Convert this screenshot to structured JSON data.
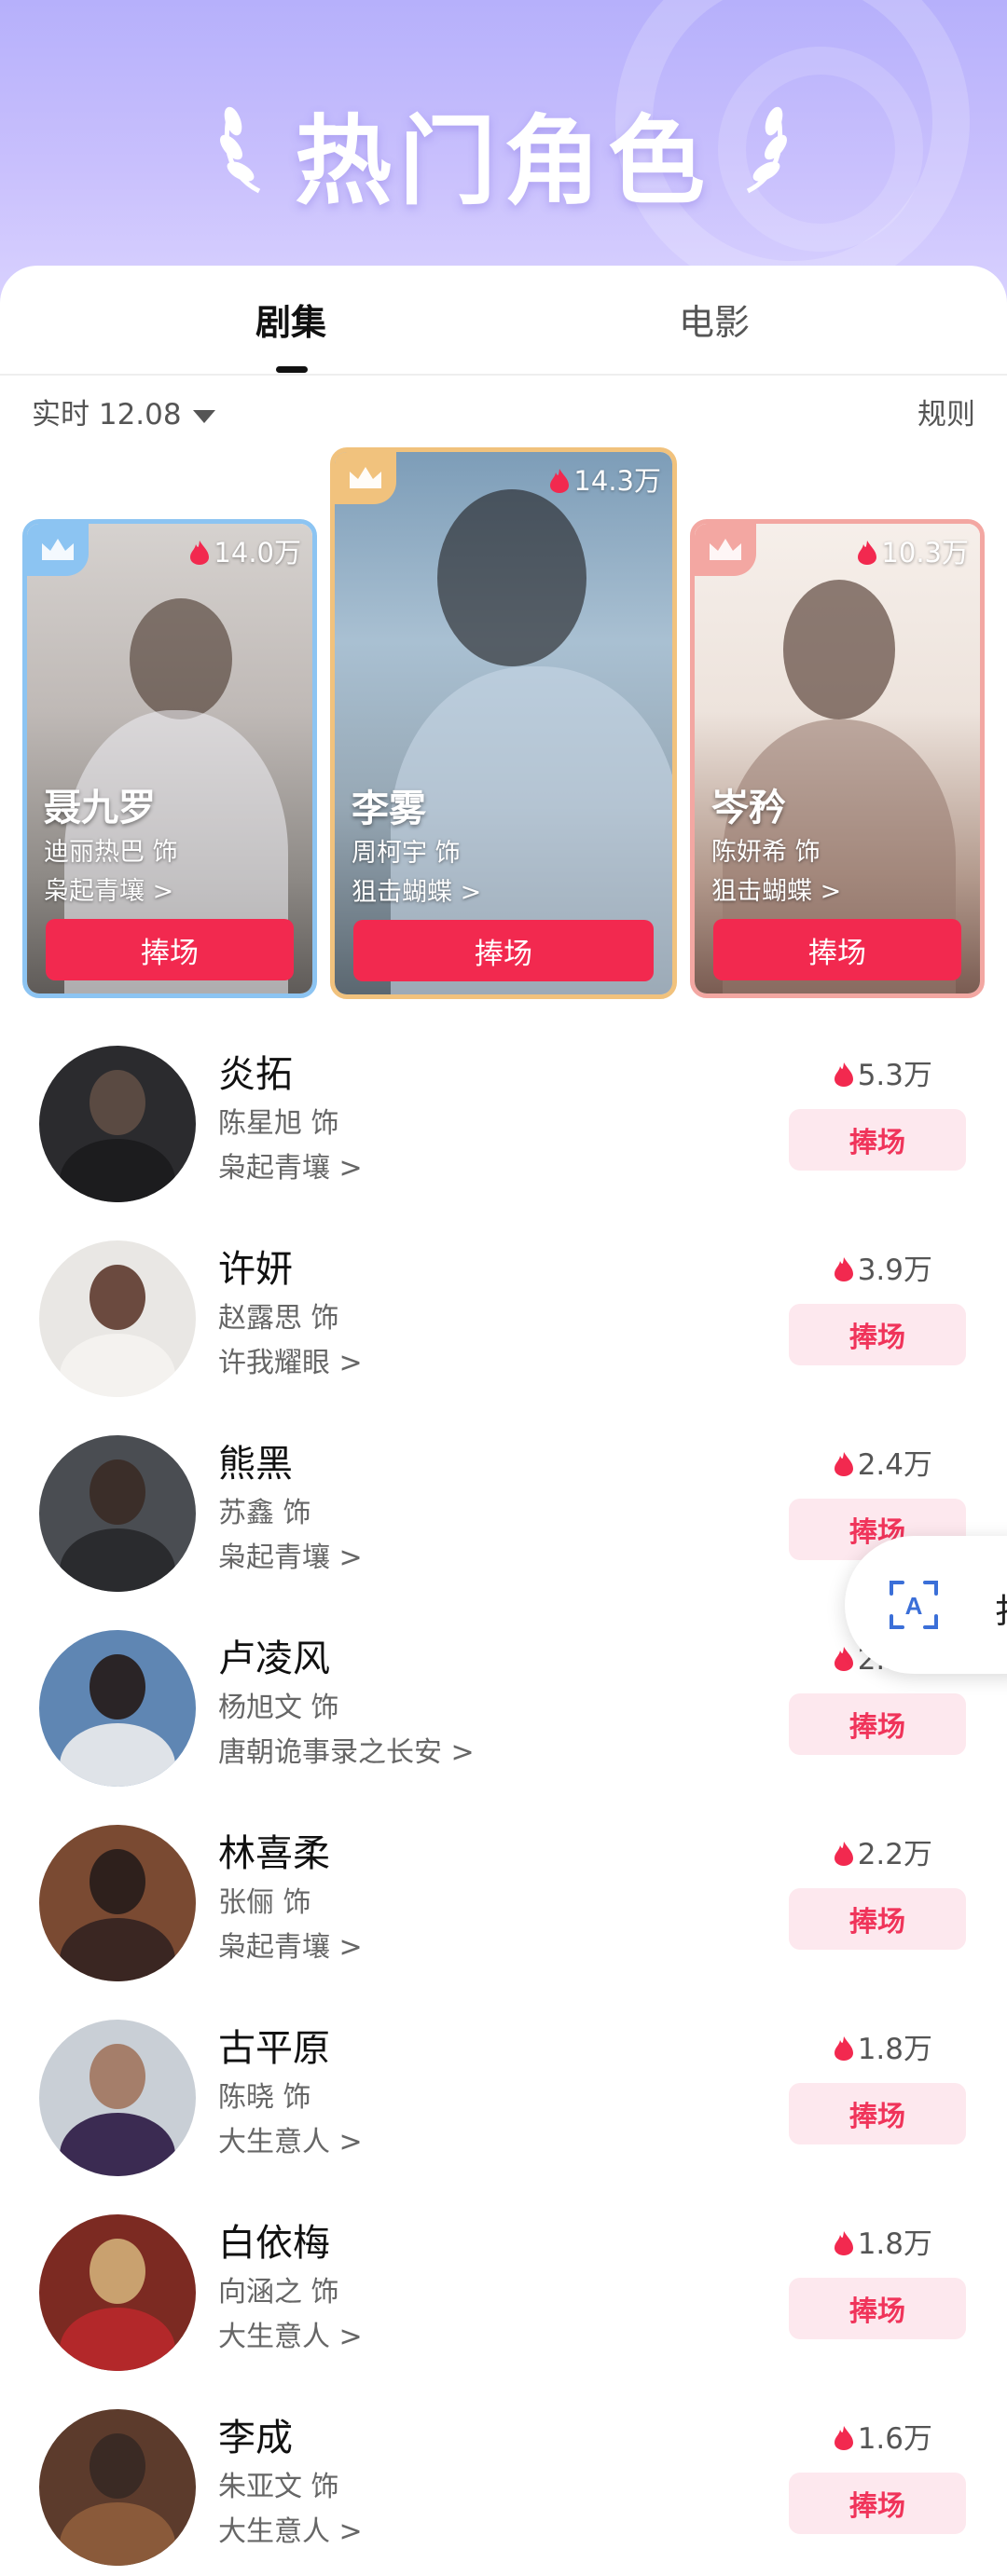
{
  "banner": {
    "title": "热门角色"
  },
  "tabs": [
    {
      "label": "剧集",
      "active": true
    },
    {
      "label": "电影",
      "active": false
    }
  ],
  "filter": {
    "label": "实时 12.08"
  },
  "rules_label": "规则",
  "top_cards": [
    {
      "rank": 2,
      "heat": "14.0万",
      "name": "聂九罗",
      "actor": "迪丽热巴 饰",
      "show": "枭起青壤 >",
      "button": "捧场"
    },
    {
      "rank": 1,
      "heat": "14.3万",
      "name": "李雾",
      "actor": "周柯宇 饰",
      "show": "狙击蝴蝶 >",
      "button": "捧场"
    },
    {
      "rank": 3,
      "heat": "10.3万",
      "name": "岑矜",
      "actor": "陈妍希 饰",
      "show": "狙击蝴蝶 >",
      "button": "捧场"
    }
  ],
  "list": [
    {
      "name": "炎拓",
      "actor": "陈星旭 饰",
      "show": "枭起青壤 >",
      "heat": "5.3万",
      "button": "捧场"
    },
    {
      "name": "许妍",
      "actor": "赵露思 饰",
      "show": "许我耀眼 >",
      "heat": "3.9万",
      "button": "捧场"
    },
    {
      "name": "熊黑",
      "actor": "苏鑫 饰",
      "show": "枭起青壤 >",
      "heat": "2.4万",
      "button": "捧场"
    },
    {
      "name": "卢凌风",
      "actor": "杨旭文 饰",
      "show": "唐朝诡事录之长安 >",
      "heat": "2.3万",
      "button": "捧场"
    },
    {
      "name": "林喜柔",
      "actor": "张俪 饰",
      "show": "枭起青壤 >",
      "heat": "2.2万",
      "button": "捧场"
    },
    {
      "name": "古平原",
      "actor": "陈晓 饰",
      "show": "大生意人 >",
      "heat": "1.8万",
      "button": "捧场"
    },
    {
      "name": "白依梅",
      "actor": "向涵之 饰",
      "show": "大生意人 >",
      "heat": "1.8万",
      "button": "捧场"
    },
    {
      "name": "李成",
      "actor": "朱亚文 饰",
      "show": "大生意人 >",
      "heat": "1.6万",
      "button": "捧场"
    }
  ],
  "float_widget": {
    "icon": "translate-icon",
    "text": "扌"
  },
  "colors": {
    "accent": "#f2294f",
    "button_soft_bg": "#fde8ee",
    "button_soft_text": "#f0345a",
    "banner": "#b6b0fb"
  }
}
